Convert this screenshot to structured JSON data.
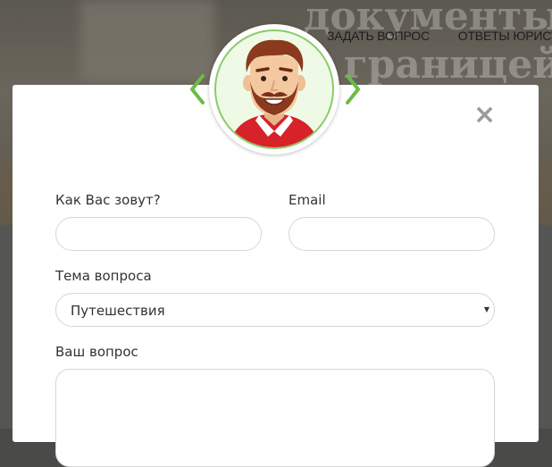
{
  "background": {
    "hero_lines": [
      "документы",
      "о границей"
    ],
    "nav": {
      "items": [
        "ЗАДАТЬ ВОПРОС",
        "ОТВЕТЫ ЮРИСТ"
      ]
    }
  },
  "modal": {
    "close_label": "×",
    "avatar": {
      "icon": "lawyer-avatar-icon",
      "prev_icon": "chevron-left-icon",
      "next_icon": "chevron-right-icon"
    },
    "form": {
      "name_label": "Как Вас зовут?",
      "name_value": "",
      "email_label": "Email",
      "email_value": "",
      "topic_label": "Тема вопроса",
      "topic_selected": "Путешествия",
      "question_label": "Ваш вопрос",
      "question_value": ""
    }
  },
  "colors": {
    "accent_green": "#6cbb45",
    "avatar_border": "#8ccb6a",
    "avatar_bg": "#eefae6",
    "input_border": "#d6d6d6",
    "overlay": "#555553"
  }
}
